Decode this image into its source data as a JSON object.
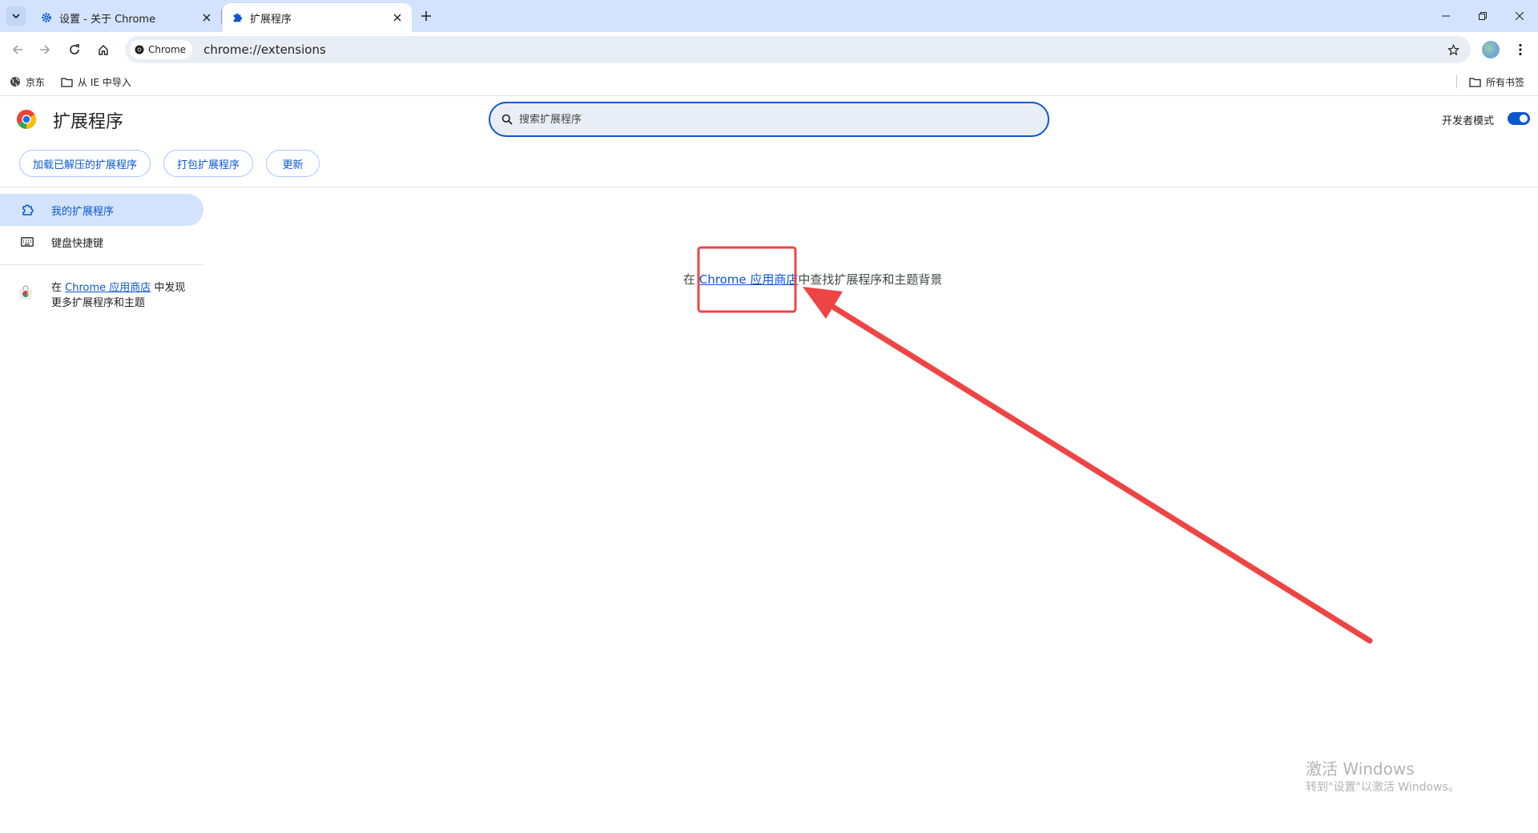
{
  "browser": {
    "tabs": [
      {
        "title": "设置 - 关于 Chrome",
        "icon": "gear-icon",
        "active": false
      },
      {
        "title": "扩展程序",
        "icon": "puzzle-icon",
        "active": true
      }
    ],
    "omnibox": {
      "chip_label": "Chrome",
      "url": "chrome://extensions"
    },
    "bookmarks": [
      {
        "label": "京东",
        "icon": "globe-icon"
      },
      {
        "label": "从 IE 中导入",
        "icon": "folder-icon"
      }
    ],
    "all_bookmarks_label": "所有书签"
  },
  "extensions_page": {
    "title": "扩展程序",
    "search_placeholder": "搜索扩展程序",
    "developer_mode_label": "开发者模式",
    "developer_mode_on": true,
    "buttons": {
      "load_unpacked": "加载已解压的扩展程序",
      "pack": "打包扩展程序",
      "update": "更新"
    },
    "sidebar": {
      "my_extensions": "我的扩展程序",
      "keyboard_shortcuts": "键盘快捷键",
      "store_promo": {
        "prefix": "在",
        "link": "Chrome 应用商店",
        "suffix": "中发现",
        "line2": "更多扩展程序和主题"
      }
    },
    "empty_message": {
      "prefix": "在",
      "link": "Chrome 应用商店",
      "suffix": "中查找扩展程序和主题背景"
    }
  },
  "watermark": {
    "line1": "激活 Windows",
    "line2": "转到\"设置\"以激活 Windows。"
  },
  "colors": {
    "accent": "#0b57d0",
    "annotation": "#ef4444"
  }
}
